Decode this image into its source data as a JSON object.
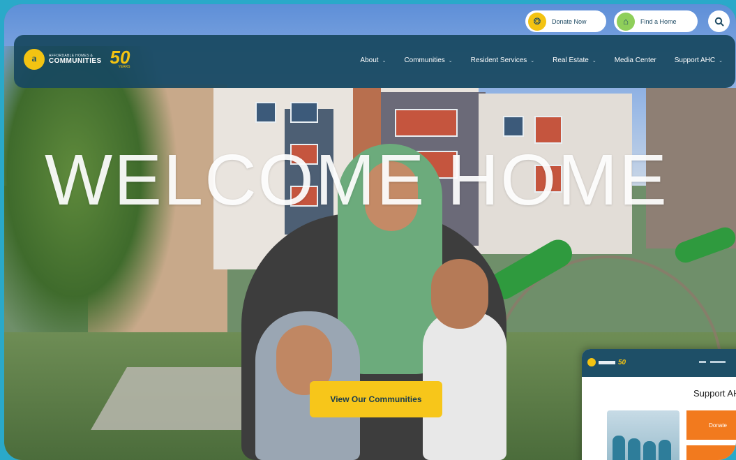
{
  "utility": {
    "donate_label": "Donate Now",
    "find_home_label": "Find a Home",
    "search_icon": "search-icon"
  },
  "brand": {
    "logo_line1": "AFFORDABLE HOMES &",
    "logo_line2": "COMMUNITIES",
    "anniversary_number": "50",
    "anniversary_suffix": "YEARS",
    "colors": {
      "navy": "#184860",
      "yellow": "#f3c312",
      "green": "#8fcf5a",
      "orange": "#f27a1e"
    }
  },
  "nav": {
    "items": [
      {
        "label": "About",
        "has_dropdown": true
      },
      {
        "label": "Communities",
        "has_dropdown": true
      },
      {
        "label": "Resident Services",
        "has_dropdown": true
      },
      {
        "label": "Real Estate",
        "has_dropdown": true
      },
      {
        "label": "Media Center",
        "has_dropdown": false
      },
      {
        "label": "Support AHC",
        "has_dropdown": true
      }
    ]
  },
  "hero": {
    "title": "WELCOME HOME",
    "cta_label": "View Our Communities"
  },
  "preview_card": {
    "anniversary_number": "50",
    "heading": "Support AH",
    "donate_label": "Donate"
  }
}
